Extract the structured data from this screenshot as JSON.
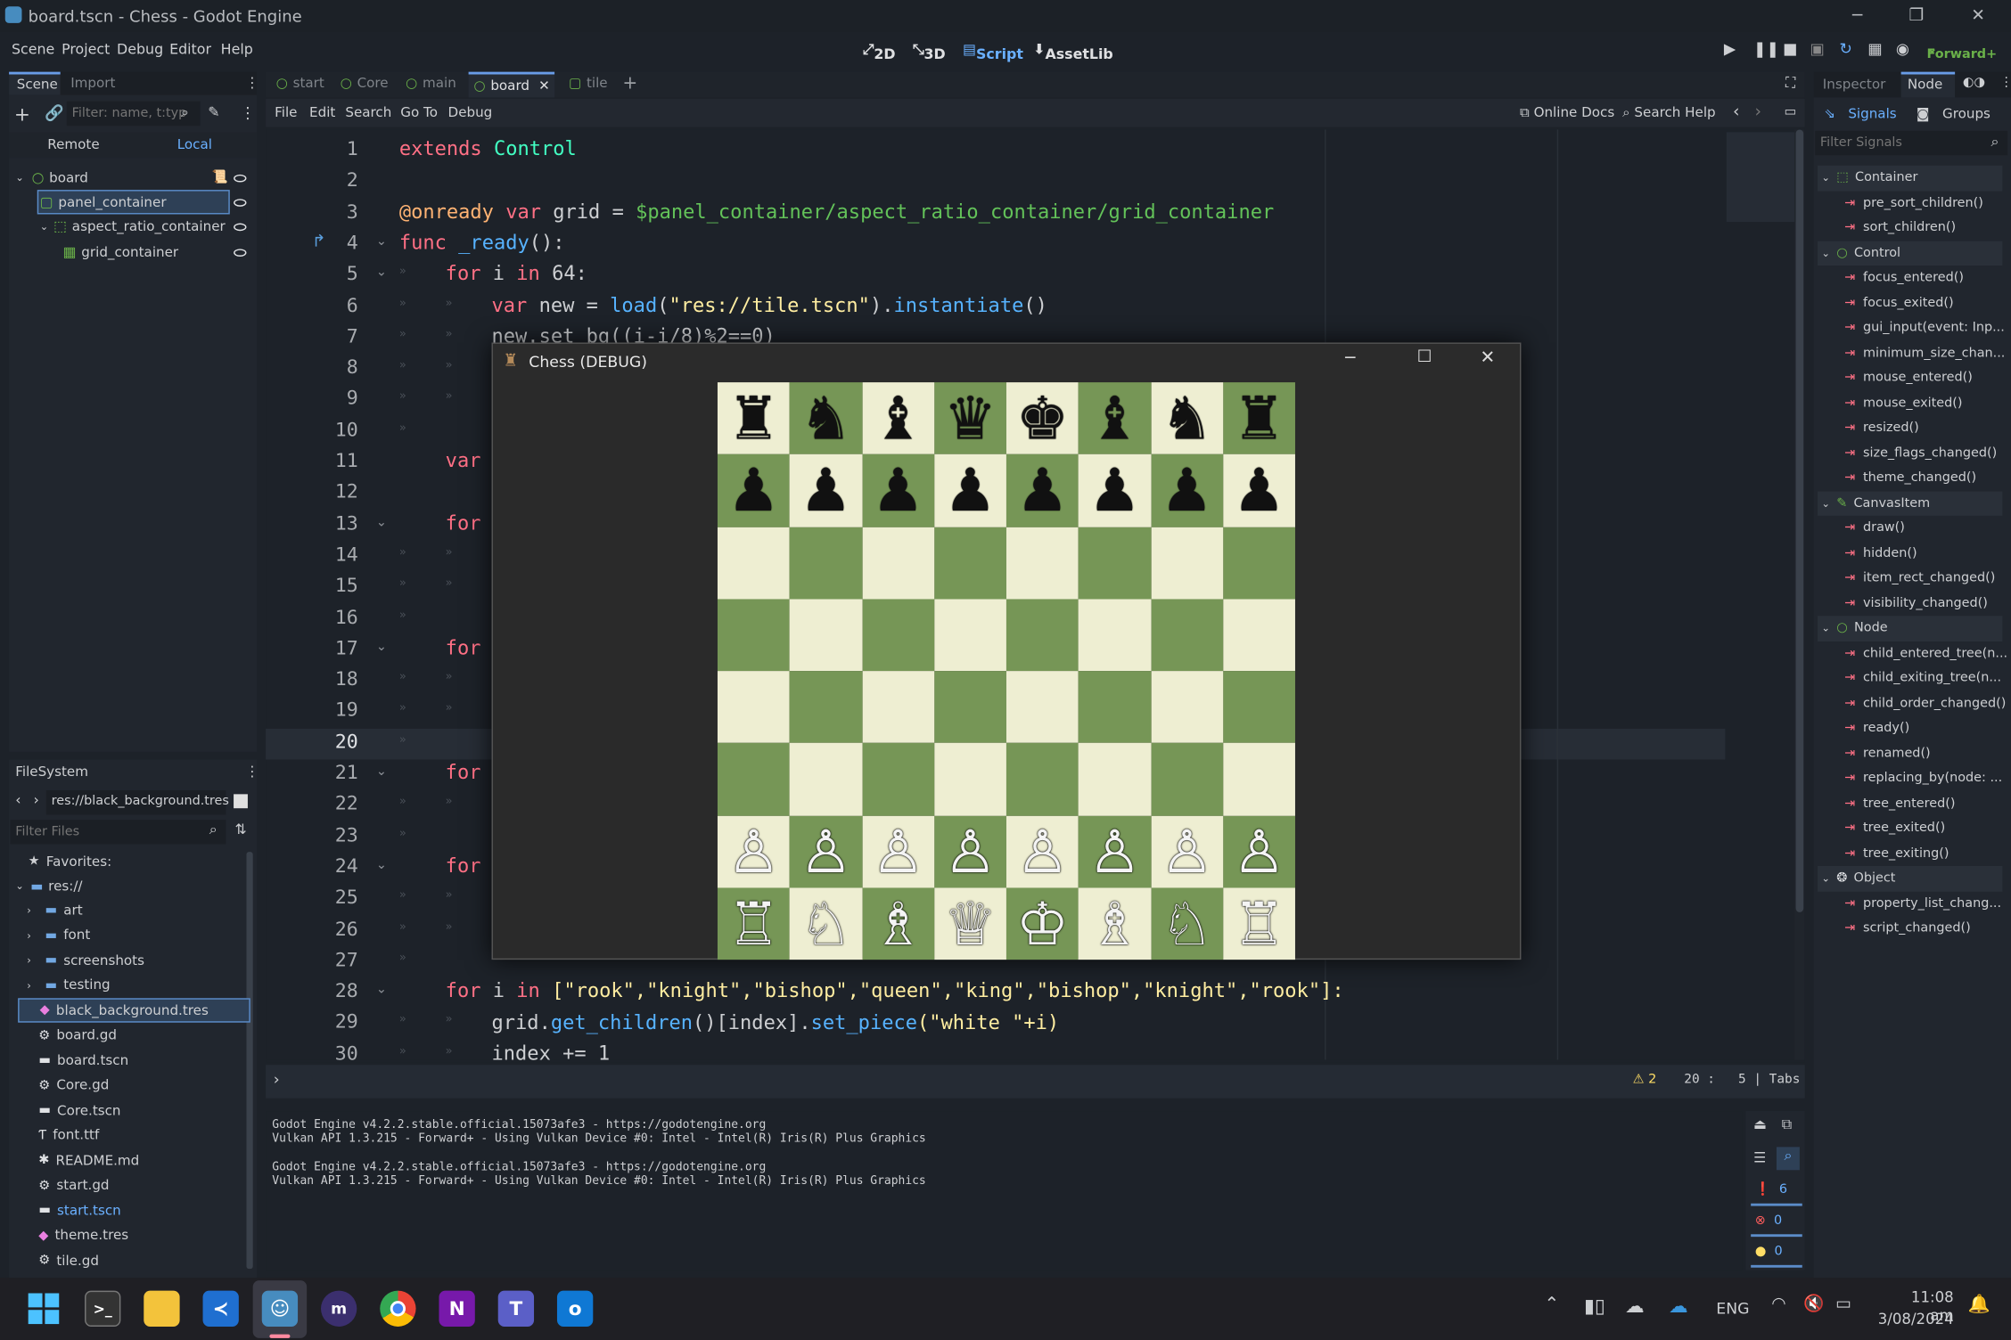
{
  "window": {
    "title": "board.tscn - Chess - Godot Engine"
  },
  "menu": [
    "Scene",
    "Project",
    "Debug",
    "Editor",
    "Help"
  ],
  "modes": {
    "m2d": "2D",
    "m3d": "3D",
    "script": "Script",
    "assetlib": "AssetLib"
  },
  "renderer": "Forward+",
  "scene_dock": {
    "tab_scene": "Scene",
    "tab_import": "Import",
    "filter_placeholder": "Filter: name, t:typ",
    "remote": "Remote",
    "local": "Local",
    "nodes": [
      "board",
      "panel_container",
      "aspect_ratio_container",
      "grid_container"
    ]
  },
  "filesystem": {
    "title": "FileSystem",
    "path": "res://black_background.tres",
    "filter_placeholder": "Filter Files",
    "favorites": "Favorites:",
    "root": "res://",
    "items": [
      "art",
      "font",
      "screenshots",
      "testing",
      "black_background.tres",
      "board.gd",
      "board.tscn",
      "Core.gd",
      "Core.tscn",
      "font.ttf",
      "README.md",
      "start.gd",
      "start.tscn",
      "theme.tres",
      "tile.gd"
    ]
  },
  "script_tabs": [
    "start",
    "Core",
    "main",
    "board",
    "tile"
  ],
  "script_menu": [
    "File",
    "Edit",
    "Search",
    "Go To",
    "Debug"
  ],
  "script_links": {
    "docs": "Online Docs",
    "help": "Search Help"
  },
  "line_numbers": [
    "1",
    "2",
    "3",
    "4",
    "5",
    "6",
    "7",
    "8",
    "9",
    "10",
    "11",
    "12",
    "13",
    "14",
    "15",
    "16",
    "17",
    "18",
    "19",
    "20",
    "21",
    "22",
    "23",
    "24",
    "25",
    "26",
    "27",
    "28",
    "29",
    "30"
  ],
  "code": {
    "l1a": "extends ",
    "l1b": "Control",
    "l3a": "@onready ",
    "l3b": "var ",
    "l3c": "grid = ",
    "l3d": "$panel_container/aspect_ratio_container/grid_container",
    "l4a": "func ",
    "l4b": "_ready",
    "l4c": "():",
    "l5a": "for ",
    "l5b": "i ",
    "l5c": "in ",
    "l5d": "64:",
    "l6a": "var ",
    "l6b": "new = ",
    "l6c": "load",
    "l6d": "(",
    "l6e": "\"res://tile.tscn\"",
    "l6f": ").",
    "l6g": "instantiate",
    "l6h": "()",
    "l7": "new.set_bg((i-i/8)%2==0)",
    "l11": "var",
    "l13": "for",
    "l17": "for",
    "l21": "for",
    "l24": "for",
    "l28a": "for ",
    "l28b": "i ",
    "l28c": "in ",
    "l28d": "[\"rook\",\"knight\",\"bishop\",\"queen\",\"king\",\"bishop\",\"knight\",\"rook\"]:",
    "l29a": "grid.",
    "l29b": "get_children",
    "l29c": "()[index].",
    "l29d": "set_piece",
    "l29e": "(\"white \"+i)",
    "l30": "index += 1"
  },
  "status": {
    "warnings": "2",
    "line": "20",
    "col": "5",
    "indent": "Tabs"
  },
  "output": [
    "Godot Engine v4.2.2.stable.official.15073afe3 - https://godotengine.org",
    "Vulkan API 1.3.215 - Forward+ - Using Vulkan Device #0: Intel - Intel(R) Iris(R) Plus Graphics",
    "",
    "Godot Engine v4.2.2.stable.official.15073afe3 - https://godotengine.org",
    "Vulkan API 1.3.215 - Forward+ - Using Vulkan Device #0: Intel - Intel(R) Iris(R) Plus Graphics"
  ],
  "output_counts": {
    "messages": "6",
    "errors": "0",
    "warnings": "0"
  },
  "inspector": {
    "tab_inspector": "Inspector",
    "tab_node": "Node",
    "signals": "Signals",
    "groups": "Groups",
    "filter_placeholder": "Filter Signals",
    "sections": [
      {
        "name": "Container",
        "signals": [
          "pre_sort_children()",
          "sort_children()"
        ]
      },
      {
        "name": "Control",
        "signals": [
          "focus_entered()",
          "focus_exited()",
          "gui_input(event: Inp...",
          "minimum_size_chan...",
          "mouse_entered()",
          "mouse_exited()",
          "resized()",
          "size_flags_changed()",
          "theme_changed()"
        ]
      },
      {
        "name": "CanvasItem",
        "signals": [
          "draw()",
          "hidden()",
          "item_rect_changed()",
          "visibility_changed()"
        ]
      },
      {
        "name": "Node",
        "signals": [
          "child_entered_tree(n...",
          "child_exiting_tree(n...",
          "child_order_changed()",
          "ready()",
          "renamed()",
          "replacing_by(node: ...",
          "tree_entered()",
          "tree_exited()",
          "tree_exiting()"
        ]
      },
      {
        "name": "Object",
        "signals": [
          "property_list_chang...",
          "script_changed()"
        ]
      }
    ]
  },
  "game": {
    "title": "Chess (DEBUG)",
    "colors": {
      "light": "#eeeed2",
      "dark": "#769656"
    },
    "rows": [
      [
        "♜",
        "♞",
        "♝",
        "♛",
        "♚",
        "♝",
        "♞",
        "♜"
      ],
      [
        "♟",
        "♟",
        "♟",
        "♟",
        "♟",
        "♟",
        "♟",
        "♟"
      ],
      [
        "",
        "",
        "",
        "",
        "",
        "",
        "",
        ""
      ],
      [
        "",
        "",
        "",
        "",
        "",
        "",
        "",
        ""
      ],
      [
        "",
        "",
        "",
        "",
        "",
        "",
        "",
        ""
      ],
      [
        "",
        "",
        "",
        "",
        "",
        "",
        "",
        ""
      ],
      [
        "♙",
        "♙",
        "♙",
        "♙",
        "♙",
        "♙",
        "♙",
        "♙"
      ],
      [
        "♖",
        "♘",
        "♗",
        "♕",
        "♔",
        "♗",
        "♘",
        "♖"
      ]
    ]
  },
  "taskbar": {
    "lang": "ENG",
    "time": "11:08 am",
    "date": "3/08/2024"
  }
}
